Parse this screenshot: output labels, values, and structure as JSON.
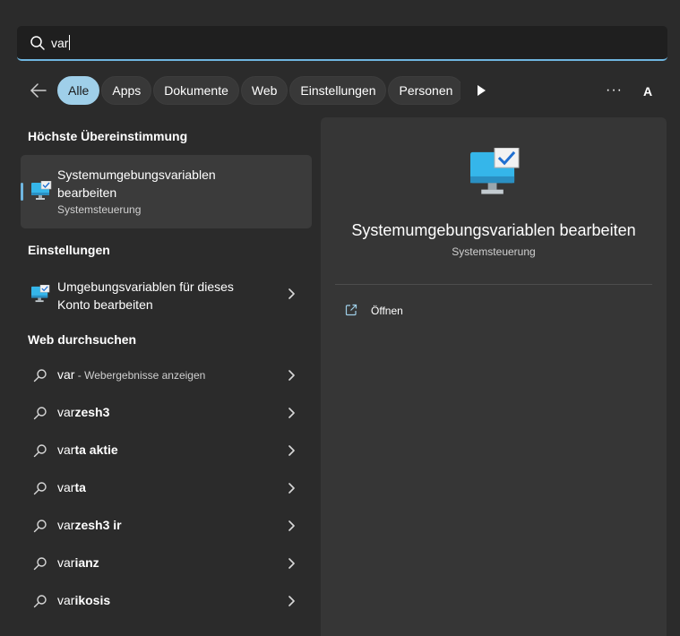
{
  "search": {
    "value": "var"
  },
  "filters": {
    "back_label": "Zurück",
    "chips": [
      "Alle",
      "Apps",
      "Dokumente",
      "Web",
      "Einstellungen",
      "Personen"
    ],
    "more_label": "···",
    "avatar_initial": "A"
  },
  "sections": {
    "best_match": "Höchste Übereinstimmung",
    "settings": "Einstellungen",
    "web": "Web durchsuchen"
  },
  "best_match": {
    "title_line1": "Systemumgebungsvariablen",
    "title_line2": "bearbeiten",
    "subtitle": "Systemsteuerung",
    "icon": "monitor-check-icon"
  },
  "settings_item": {
    "line1": "Umgebungsvariablen für dieses",
    "line2": "Konto bearbeiten",
    "icon": "monitor-check-icon"
  },
  "web_results": [
    {
      "query": "var",
      "suffix": "",
      "hint": " - Webergebnisse anzeigen"
    },
    {
      "query": "var",
      "suffix": "zesh3",
      "hint": ""
    },
    {
      "query": "var",
      "suffix": "ta aktie",
      "hint": ""
    },
    {
      "query": "var",
      "suffix": "ta",
      "hint": ""
    },
    {
      "query": "var",
      "suffix": "zesh3 ir",
      "hint": ""
    },
    {
      "query": "var",
      "suffix": "ianz",
      "hint": ""
    },
    {
      "query": "var",
      "suffix": "ikosis",
      "hint": ""
    }
  ],
  "detail": {
    "title": "Systemumgebungsvariablen bearbeiten",
    "subtitle": "Systemsteuerung",
    "action_open": "Öffnen"
  },
  "colors": {
    "accent": "#6fb6e0",
    "active_chip": "#9fcfe9",
    "panel": "#2b2b2b",
    "detail": "#363636"
  }
}
